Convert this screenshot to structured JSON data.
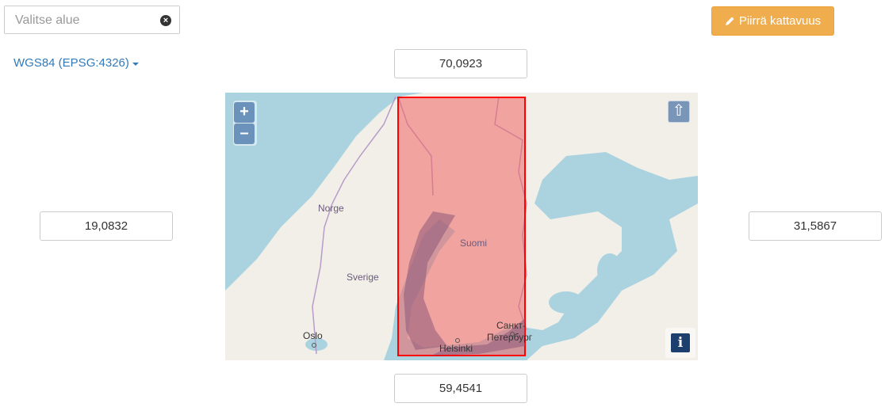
{
  "area_select": {
    "placeholder": "Valitse alue",
    "clear_icon": "times-circle-icon"
  },
  "draw_button": {
    "label": "Piirrä kattavuus",
    "icon": "pencil-icon",
    "color": "#f0ad4e"
  },
  "crs_dropdown": {
    "label": "WGS84 (EPSG:4326)",
    "icon": "caret-down-icon",
    "color": "#337ab7"
  },
  "bounds": {
    "north": "70,0923",
    "south": "59,4541",
    "west": "19,0832",
    "east": "31,5867"
  },
  "map": {
    "zoom_in": "+",
    "zoom_out": "–",
    "north_reset_icon": "arrow-up-icon",
    "info_label": "i",
    "labels": {
      "norway": "Norge",
      "sweden": "Sverige",
      "finland": "Suomi",
      "oslo": "Oslo",
      "helsinki": "Helsinki",
      "spb_line1": "Санкт-",
      "spb_line2": "Петербург"
    },
    "colors": {
      "water": "#aad3df",
      "land": "#f2efe9",
      "coverage_fill": "#f08080",
      "coverage_stroke": "#ff0000"
    }
  }
}
